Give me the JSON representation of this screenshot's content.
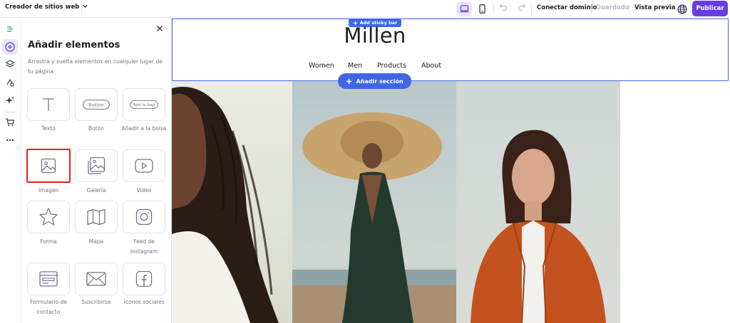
{
  "topbar": {
    "builder_label": "Creador de sitios web",
    "connect_domain": "Conectar dominio",
    "saved": "Guardado",
    "preview": "Vista previa",
    "publish": "Publicar"
  },
  "panel": {
    "title": "Añadir elementos",
    "description": "Arrastra y suelta elementos en cualquier lugar de tu página",
    "tiles": [
      {
        "label": "Texto",
        "icon": "text-icon"
      },
      {
        "label": "Botón",
        "icon": "button-icon",
        "mini": "Button"
      },
      {
        "label": "Añadir a la bolsa",
        "icon": "add-to-bag-icon",
        "mini": "Add to bag"
      },
      {
        "label": "Imagen",
        "icon": "image-icon"
      },
      {
        "label": "Galería",
        "icon": "gallery-icon"
      },
      {
        "label": "Video",
        "icon": "video-icon"
      },
      {
        "label": "Forma",
        "icon": "star-shape-icon"
      },
      {
        "label": "Mapa",
        "icon": "map-icon"
      },
      {
        "label": "Feed de Instagram",
        "icon": "instagram-icon"
      },
      {
        "label": "Formulario de contacto",
        "icon": "contact-form-icon"
      },
      {
        "label": "Suscribirse",
        "icon": "envelope-icon"
      },
      {
        "label": "Íconos sociales",
        "icon": "facebook-icon"
      }
    ]
  },
  "canvas": {
    "sticky_bar": "Add sticky bar",
    "logo": "Millen",
    "nav": [
      "Women",
      "Men",
      "Products",
      "About"
    ],
    "add_section": "Añadir sección"
  },
  "colors": {
    "accent": "#673de6",
    "editor_blue": "#3f67e4",
    "selection_red": "#e1251b"
  }
}
